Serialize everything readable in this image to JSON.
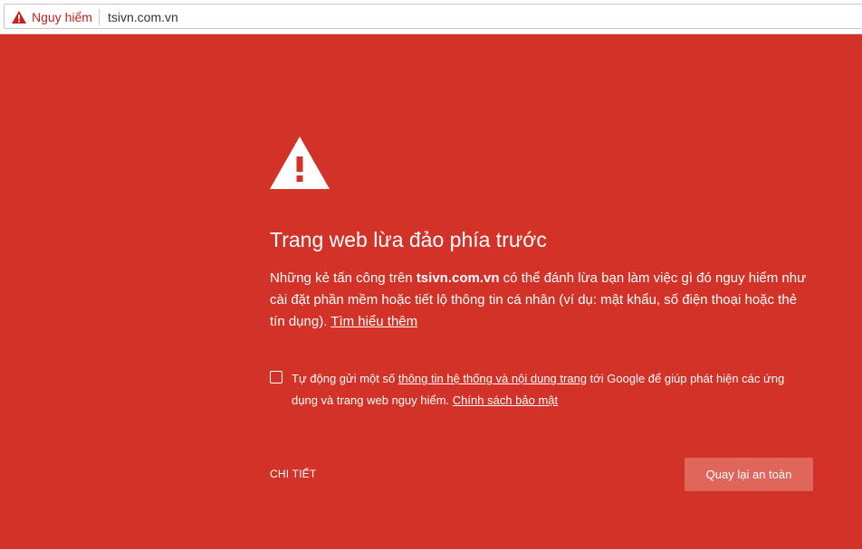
{
  "toolbar": {
    "security_label": "Nguy hiểm",
    "url": "tsivn.com.vn"
  },
  "interstitial": {
    "heading": "Trang web lừa đảo phía trước",
    "body_prefix": "Những kẻ tấn công trên ",
    "body_domain": "tsivn.com.vn",
    "body_suffix": " có thể đánh lừa bạn làm việc gì đó nguy hiểm như cài đặt phần mềm hoặc tiết lộ thông tin cá nhân (ví dụ: mật khẩu, số điện thoại hoặc thẻ tín dụng). ",
    "learn_more_link": "Tìm hiểu thêm",
    "optin": {
      "checked": false,
      "prefix": "Tự động gửi một số ",
      "link1": "thông tin hệ thống và nội dung trang",
      "middle": " tới Google để giúp phát hiện các ứng dụng và trang web nguy hiểm. ",
      "link2": "Chính sách bảo mật"
    },
    "details_button": "CHI TIẾT",
    "back_button": "Quay lại an toàn"
  },
  "colors": {
    "background": "#d33228",
    "danger_text": "#c5221f",
    "primary_button": "#e0655b"
  },
  "icons": {
    "security_chip": "warning-triangle-icon",
    "main": "warning-triangle-icon"
  }
}
